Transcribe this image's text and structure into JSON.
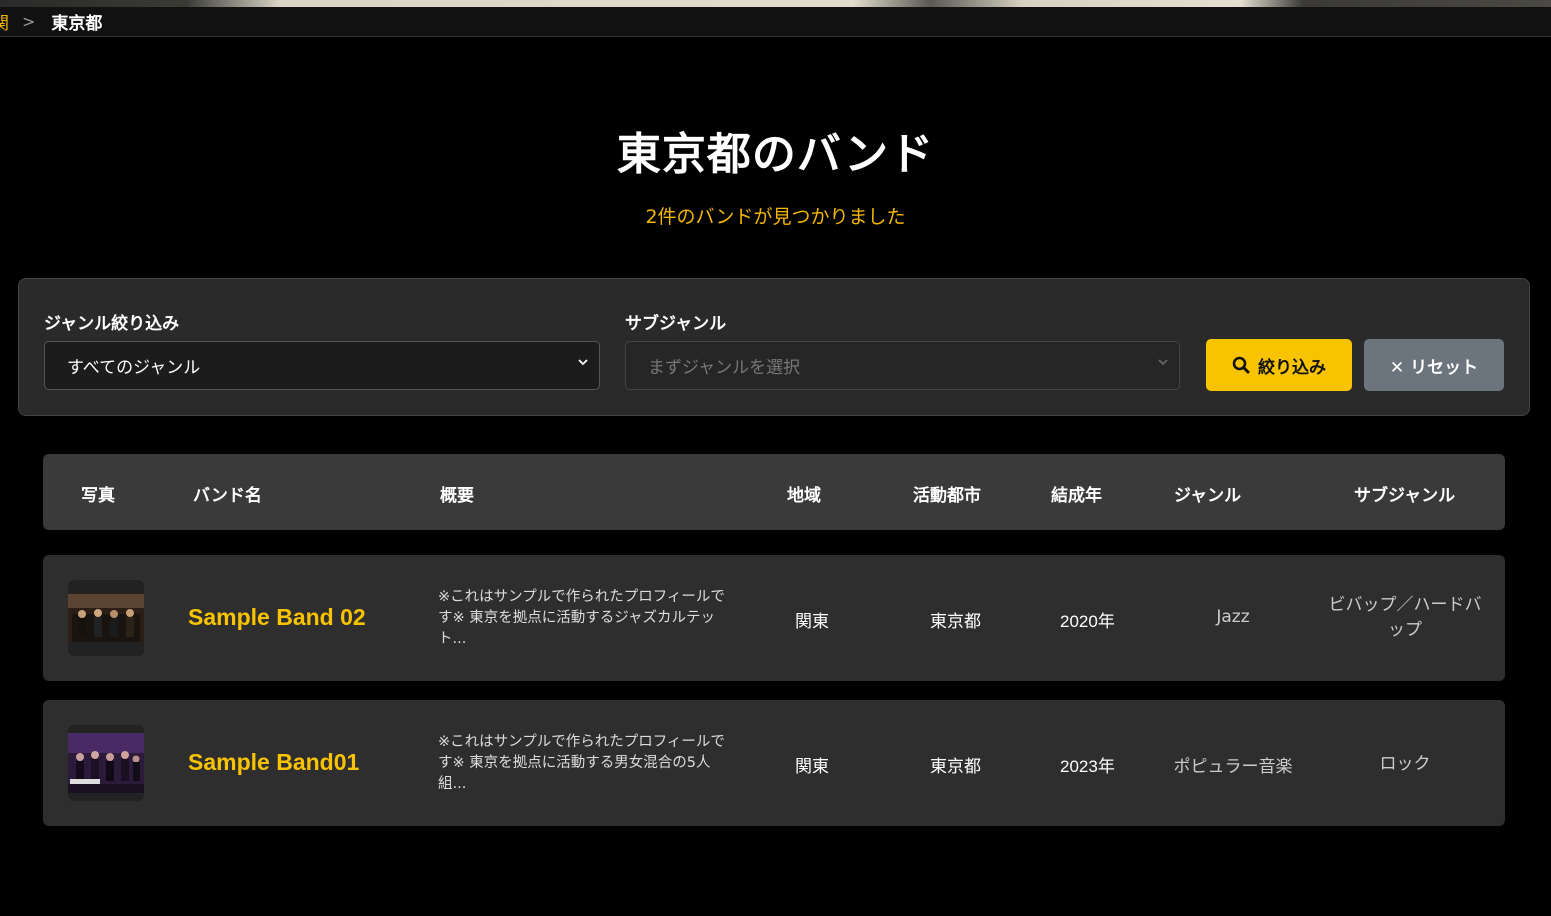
{
  "breadcrumb": {
    "prev": "関東",
    "separator": ">",
    "current": "東京都"
  },
  "page": {
    "title": "東京都のバンド",
    "result_count": "2件のバンドが見つかりました"
  },
  "filters": {
    "genre_label": "ジャンル絞り込み",
    "genre_value": "すべてのジャンル",
    "subgenre_label": "サブジャンル",
    "subgenre_placeholder": "まずジャンルを選択",
    "filter_button": "絞り込み",
    "reset_button": "✕ リセット"
  },
  "table": {
    "columns": [
      "写真",
      "バンド名",
      "概要",
      "地域",
      "活動都市",
      "結成年",
      "ジャンル",
      "サブジャンル"
    ],
    "rows": [
      {
        "name": "Sample Band 02",
        "summary": "※これはサンプルで作られたプロフィールです※ 東京を拠点に活動するジャズカルテット...",
        "region": "関東",
        "city": "東京都",
        "year": "2020年",
        "genre": "Jazz",
        "subgenre": "ビバップ／ハードバップ"
      },
      {
        "name": "Sample Band01",
        "summary": "※これはサンプルで作られたプロフィールです※ 東京を拠点に活動する男女混合の5人組...",
        "region": "関東",
        "city": "東京都",
        "year": "2023年",
        "genre": "ポピュラー音楽",
        "subgenre": "ロック"
      }
    ]
  },
  "colors": {
    "accent": "#f8c300",
    "background": "#000000",
    "panel": "#2a2a2a",
    "reset": "#6c757d"
  },
  "icons": {
    "filter": "search-icon",
    "select": "chevron-down-icon"
  }
}
